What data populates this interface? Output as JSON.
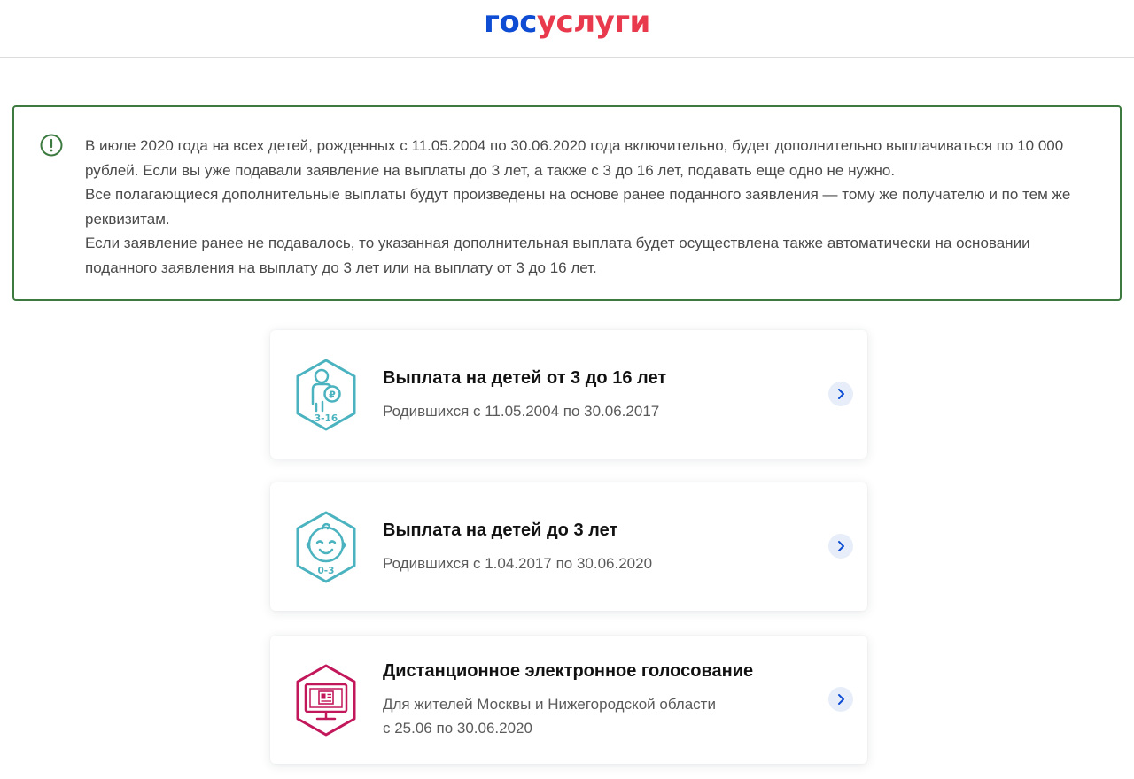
{
  "header": {
    "logo_part1": "гос",
    "logo_part2": "услуги"
  },
  "notice": {
    "paragraphs": [
      "В июле 2020 года на всех детей, рожденных с 11.05.2004 по 30.06.2020 года включительно, будет дополнительно выплачиваться по 10 000 рублей. Если вы уже подавали заявление на выплаты до 3 лет, а также с 3 до 16 лет, подавать еще одно не нужно.",
      "Все полагающиеся дополнительные выплаты будут произведены на основе ранее поданного заявления — тому же получателю и по тем же реквизитам.",
      "Если заявление ранее не подавалось, то указанная дополнительная выплата будет осуществлена также автоматически на основании поданного заявления на выплату до 3 лет или на выплату от 3 до 16 лет."
    ]
  },
  "cards": [
    {
      "title": "Выплата на детей от 3 до 16 лет",
      "subtitle": "Родившихся с 11.05.2004 по 30.06.2017",
      "icon_label": "3-16",
      "icon_badge": "₽",
      "icon": "child-ruble-icon"
    },
    {
      "title": "Выплата на детей до 3 лет",
      "subtitle": "Родившихся с 1.04.2017 по 30.06.2020",
      "icon_label": "0-3",
      "icon": "baby-face-icon"
    },
    {
      "title": "Дистанционное электронное голосование",
      "subtitle_line1": "Для жителей Москвы и Нижегородской области",
      "subtitle_line2": "с 25.06 по 30.06.2020",
      "icon": "monitor-ballot-icon"
    }
  ],
  "colors": {
    "brand_blue": "#0d4cd3",
    "brand_red": "#e8394d",
    "notice_border": "#3c7a3f",
    "teal_icon": "#4ab3bf",
    "magenta_icon": "#c2185b",
    "chevron_bg": "#e7eef9",
    "chevron": "#0d4cd3"
  }
}
